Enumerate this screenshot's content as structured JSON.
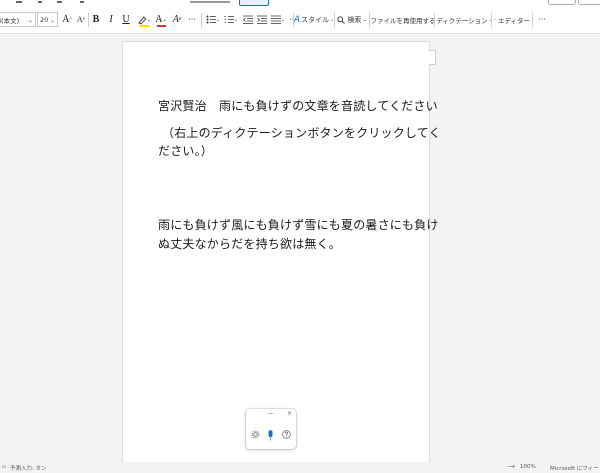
{
  "toolbar": {
    "font_name": "fi(本文)",
    "font_size": "20",
    "grow_font": "A",
    "shrink_font": "A",
    "clear_format": "A",
    "bold": "B",
    "italic": "I",
    "underline": "U",
    "font_color": "A",
    "text_effects": "A",
    "more_1": "···",
    "styles_label": "スタイル",
    "search_label": "検索",
    "reuse_file_label": "ファイルを再使用する",
    "dictation_label": "ディクテーション",
    "editor_label": "エディター",
    "more_2": "···"
  },
  "document": {
    "line1": "宮沢賢治　雨にも負けずの文章を音読してください",
    "line2": "（右上のディクテーションボタンをクリックしてく",
    "line3": "ださい。）",
    "line4": "雨にも負けず風にも負けず雪にも夏の暑さにも負け",
    "line5": "ぬ丈夫なからだを持ち欲は無く。"
  },
  "dictation_panel": {
    "close": "×"
  },
  "statusbar": {
    "left_text": "予測入力: オン",
    "zoom_out": "—",
    "zoom_in": "+",
    "zoom": "100%",
    "feedback": "Microsoft にフィードバック"
  }
}
